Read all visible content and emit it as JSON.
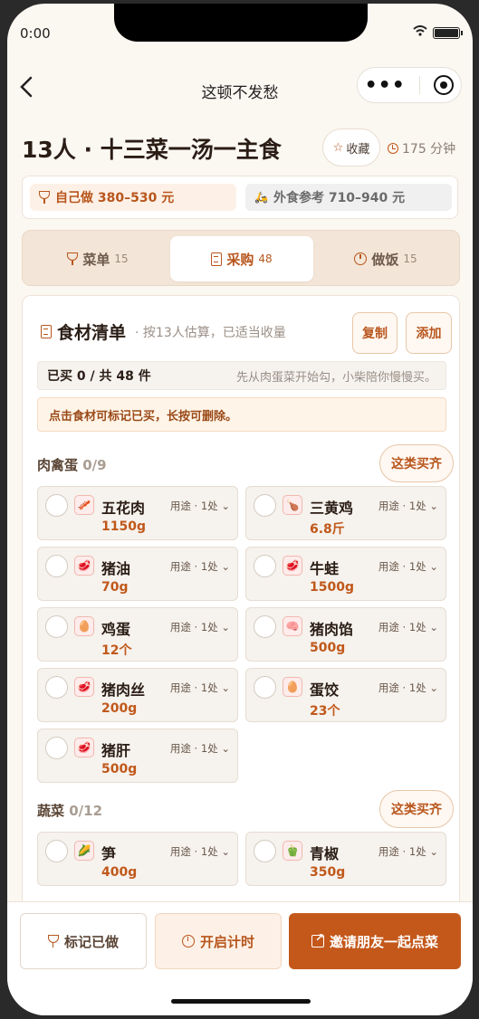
{
  "status": {
    "time": "0:00"
  },
  "nav": {
    "title": "这顿不发愁",
    "back": "‹",
    "more": "•••"
  },
  "header": {
    "title": "13人 · 十三菜一汤一主食",
    "fav_label": "收藏",
    "duration": "175 分钟"
  },
  "cost": {
    "self": "自己做 380–530 元",
    "out": "外食参考 710–940 元"
  },
  "tabs": [
    {
      "label": "菜单",
      "count": "15"
    },
    {
      "label": "采购",
      "count": "48"
    },
    {
      "label": "做饭",
      "count": "15"
    }
  ],
  "list": {
    "title": "食材清单",
    "subtitle": "· 按13人估算，已适当收量",
    "copy_label": "复制",
    "add_label": "添加",
    "summary": "已买 0 / 共 48 件",
    "summary_hint": "先从肉蛋菜开始勾，小柴陪你慢慢买。",
    "tip": "点击食材可标记已买，长按可删除。"
  },
  "categories": [
    {
      "name": "肉禽蛋",
      "progress": "0/9",
      "buy_all": "这类买齐",
      "items": [
        {
          "name": "五花肉",
          "qty": "1150g",
          "use": "用途 · 1处",
          "icon": "🥓"
        },
        {
          "name": "三黄鸡",
          "qty": "6.8斤",
          "use": "用途 · 1处",
          "icon": "🍗"
        },
        {
          "name": "猪油",
          "qty": "70g",
          "use": "用途 · 1处",
          "icon": "🥩"
        },
        {
          "name": "牛蛙",
          "qty": "1500g",
          "use": "用途 · 1处",
          "icon": "🥩"
        },
        {
          "name": "鸡蛋",
          "qty": "12个",
          "use": "用途 · 1处",
          "icon": "🥚"
        },
        {
          "name": "猪肉馅",
          "qty": "500g",
          "use": "用途 · 1处",
          "icon": "🧠"
        },
        {
          "name": "猪肉丝",
          "qty": "200g",
          "use": "用途 · 1处",
          "icon": "🥩"
        },
        {
          "name": "蛋饺",
          "qty": "23个",
          "use": "用途 · 1处",
          "icon": "🥚"
        },
        {
          "name": "猪肝",
          "qty": "500g",
          "use": "用途 · 1处",
          "icon": "🥩"
        }
      ]
    },
    {
      "name": "蔬菜",
      "progress": "0/12",
      "buy_all": "这类买齐",
      "items": [
        {
          "name": "笋",
          "qty": "400g",
          "use": "用途 · 1处",
          "icon": "🌽"
        },
        {
          "name": "青椒",
          "qty": "350g",
          "use": "用途 · 1处",
          "icon": "🫑"
        }
      ]
    }
  ],
  "bottom": {
    "mark_done": "标记已做",
    "start_timer": "开启计时",
    "invite": "邀请朋友一起点菜"
  },
  "colors": {
    "accent": "#c4581a",
    "accent_light": "#fdf1e7",
    "bg": "#fbf7f1"
  }
}
